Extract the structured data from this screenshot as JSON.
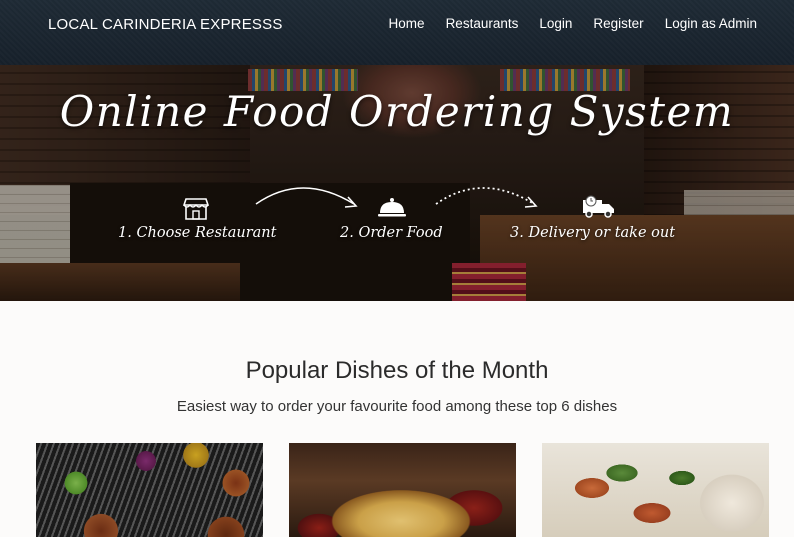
{
  "navbar": {
    "brand": "LOCAL CARINDERIA EXPRESSS",
    "links": [
      "Home",
      "Restaurants",
      "Login",
      "Register",
      "Login as Admin"
    ]
  },
  "hero": {
    "title": "Online Food Ordering System",
    "steps": [
      {
        "label": "1. Choose Restaurant",
        "icon": "store-icon"
      },
      {
        "label": "2. Order Food",
        "icon": "cloche-icon"
      },
      {
        "label": "3. Delivery or take out",
        "icon": "delivery-truck-icon"
      }
    ]
  },
  "section": {
    "title": "Popular Dishes of the Month",
    "subtitle": "Easiest way to order your favourite food among these top 6 dishes"
  },
  "colors": {
    "navbar_bg": "#1b2631",
    "nav_text": "#ffffff",
    "page_bg": "#fcfbfa"
  }
}
